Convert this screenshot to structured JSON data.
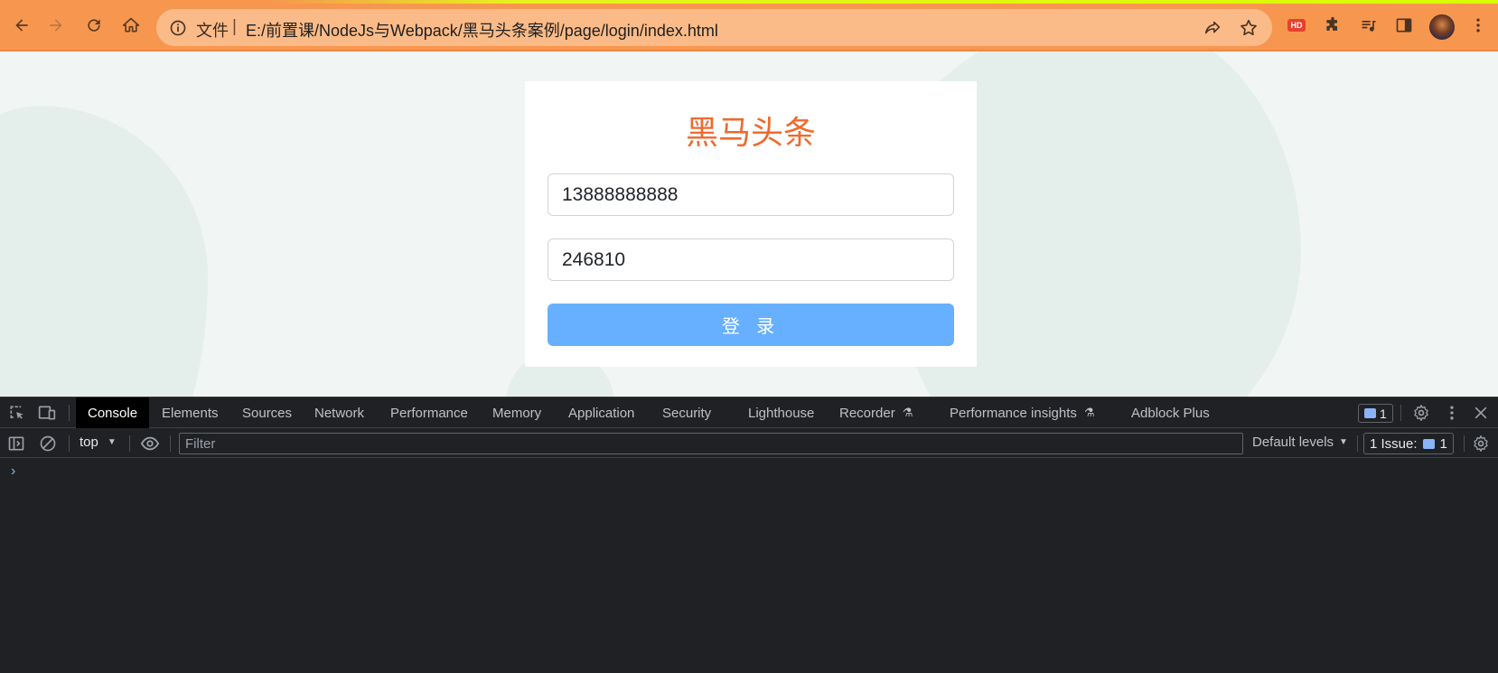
{
  "browser": {
    "scheme_label": "文件",
    "url": "E:/前置课/NodeJs与Webpack/黑马头条案例/page/login/index.html",
    "hd_badge": "HD"
  },
  "page": {
    "title": "黑马头条",
    "phone_value": "13888888888",
    "password_value": "246810",
    "login_button": "登 录",
    "colors": {
      "title": "#ef6a2e",
      "button": "#66b0ff",
      "background": "#f1f6f4"
    }
  },
  "devtools": {
    "tabs": [
      {
        "label": "Console",
        "active": true
      },
      {
        "label": "Elements"
      },
      {
        "label": "Sources"
      },
      {
        "label": "Network"
      },
      {
        "label": "Performance"
      },
      {
        "label": "Memory"
      },
      {
        "label": "Application"
      },
      {
        "label": "Security"
      },
      {
        "label": "Lighthouse"
      },
      {
        "label": "Recorder",
        "experimental": true
      },
      {
        "label": "Performance insights",
        "experimental": true
      },
      {
        "label": "Adblock Plus"
      }
    ],
    "message_count": "1",
    "context": "top",
    "filter_placeholder": "Filter",
    "levels": "Default levels",
    "issues_label": "1 Issue:",
    "issues_count": "1",
    "prompt": "›"
  }
}
